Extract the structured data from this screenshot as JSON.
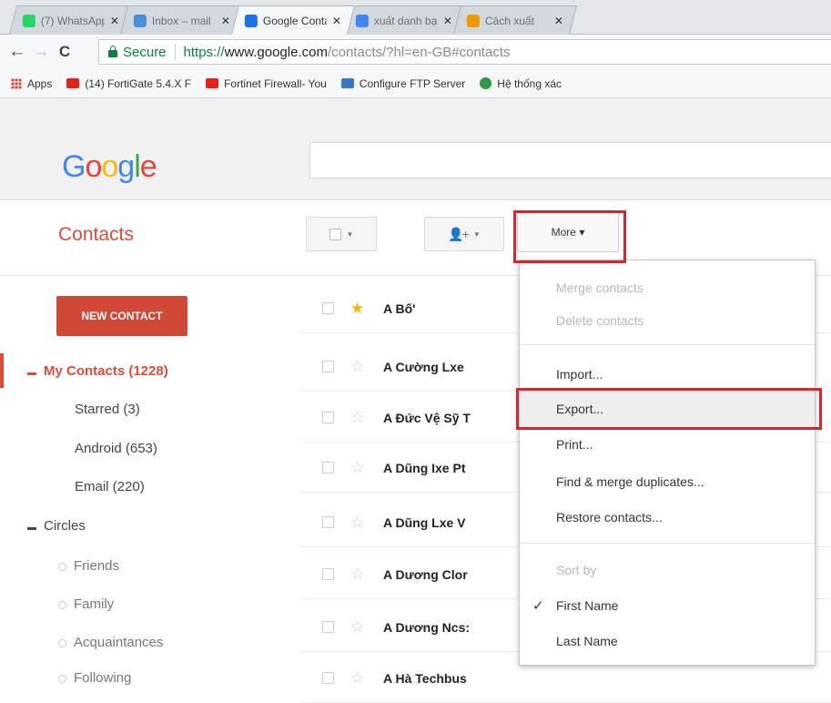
{
  "browser": {
    "tabs": [
      {
        "title": "(7) WhatsApp",
        "icon": "whatsapp-icon",
        "color": "#25d366"
      },
      {
        "title": "Inbox – mail",
        "icon": "gmail-icon",
        "color": "#4a90d9"
      },
      {
        "title": "Google Contacts",
        "icon": "contacts-icon",
        "color": "#1a73e8",
        "active": true
      },
      {
        "title": "xuất danh bạ",
        "icon": "google-icon",
        "color": "#4285f4"
      },
      {
        "title": "Cách xuất",
        "icon": "site-icon",
        "color": "#f29900"
      }
    ],
    "tab_close": "✕",
    "back": "←",
    "forward": "→",
    "reload": "C",
    "secure_label": "Secure",
    "url_scheme": "https://",
    "url_host": "www.google.com",
    "url_rest": "/contacts/?hl=en-GB#contacts",
    "bookmarks": [
      {
        "label": "Apps",
        "icon": "apps-grid-icon",
        "color": "#e8453c"
      },
      {
        "label": "(14) FortiGate 5.4.X F",
        "icon": "youtube-icon",
        "color": "#e62117"
      },
      {
        "label": "Fortinet Firewall- You",
        "icon": "youtube-icon",
        "color": "#e62117"
      },
      {
        "label": "Configure FTP Server",
        "icon": "ftp-icon",
        "color": "#3b78c3"
      },
      {
        "label": "Hệ thống xác",
        "icon": "globe-icon",
        "color": "#2e9a3e"
      }
    ]
  },
  "header": {
    "logo": [
      "G",
      "o",
      "o",
      "g",
      "l",
      "e"
    ],
    "logo_colors": [
      "#4285f4",
      "#ea4335",
      "#fbbc05",
      "#4285f4",
      "#34a853",
      "#ea4335"
    ]
  },
  "app_title": "Contacts",
  "toolbar": {
    "more_label": "More ▾"
  },
  "sidebar": {
    "new_contact": "NEW CONTACT",
    "my_contacts": "My Contacts (1228)",
    "groups": [
      "Starred (3)",
      "Android (653)",
      "Email (220)"
    ],
    "circles": "Circles",
    "circle_items": [
      "Friends",
      "Family",
      "Acquaintances",
      "Following"
    ]
  },
  "contacts": [
    {
      "name": "A Bố'",
      "starred": true
    },
    {
      "name": "A Cường Lxe",
      "starred": false
    },
    {
      "name": "A Đức Vệ Sỹ T",
      "starred": false
    },
    {
      "name": "A Dũng Ixe Pt",
      "starred": false
    },
    {
      "name": "A Dũng Lxe V",
      "starred": false
    },
    {
      "name": "A Dương Clor",
      "starred": false
    },
    {
      "name": "A Dương Ncs:",
      "starred": false
    },
    {
      "name": "A Hà Techbus",
      "starred": false
    }
  ],
  "menu": {
    "merge": "Merge contacts",
    "delete": "Delete contacts",
    "import": "Import...",
    "export": "Export...",
    "print": "Print...",
    "find_merge": "Find & merge duplicates...",
    "restore": "Restore contacts...",
    "sort_by": "Sort by",
    "first_name": "First Name",
    "last_name": "Last Name",
    "check": "✓"
  }
}
